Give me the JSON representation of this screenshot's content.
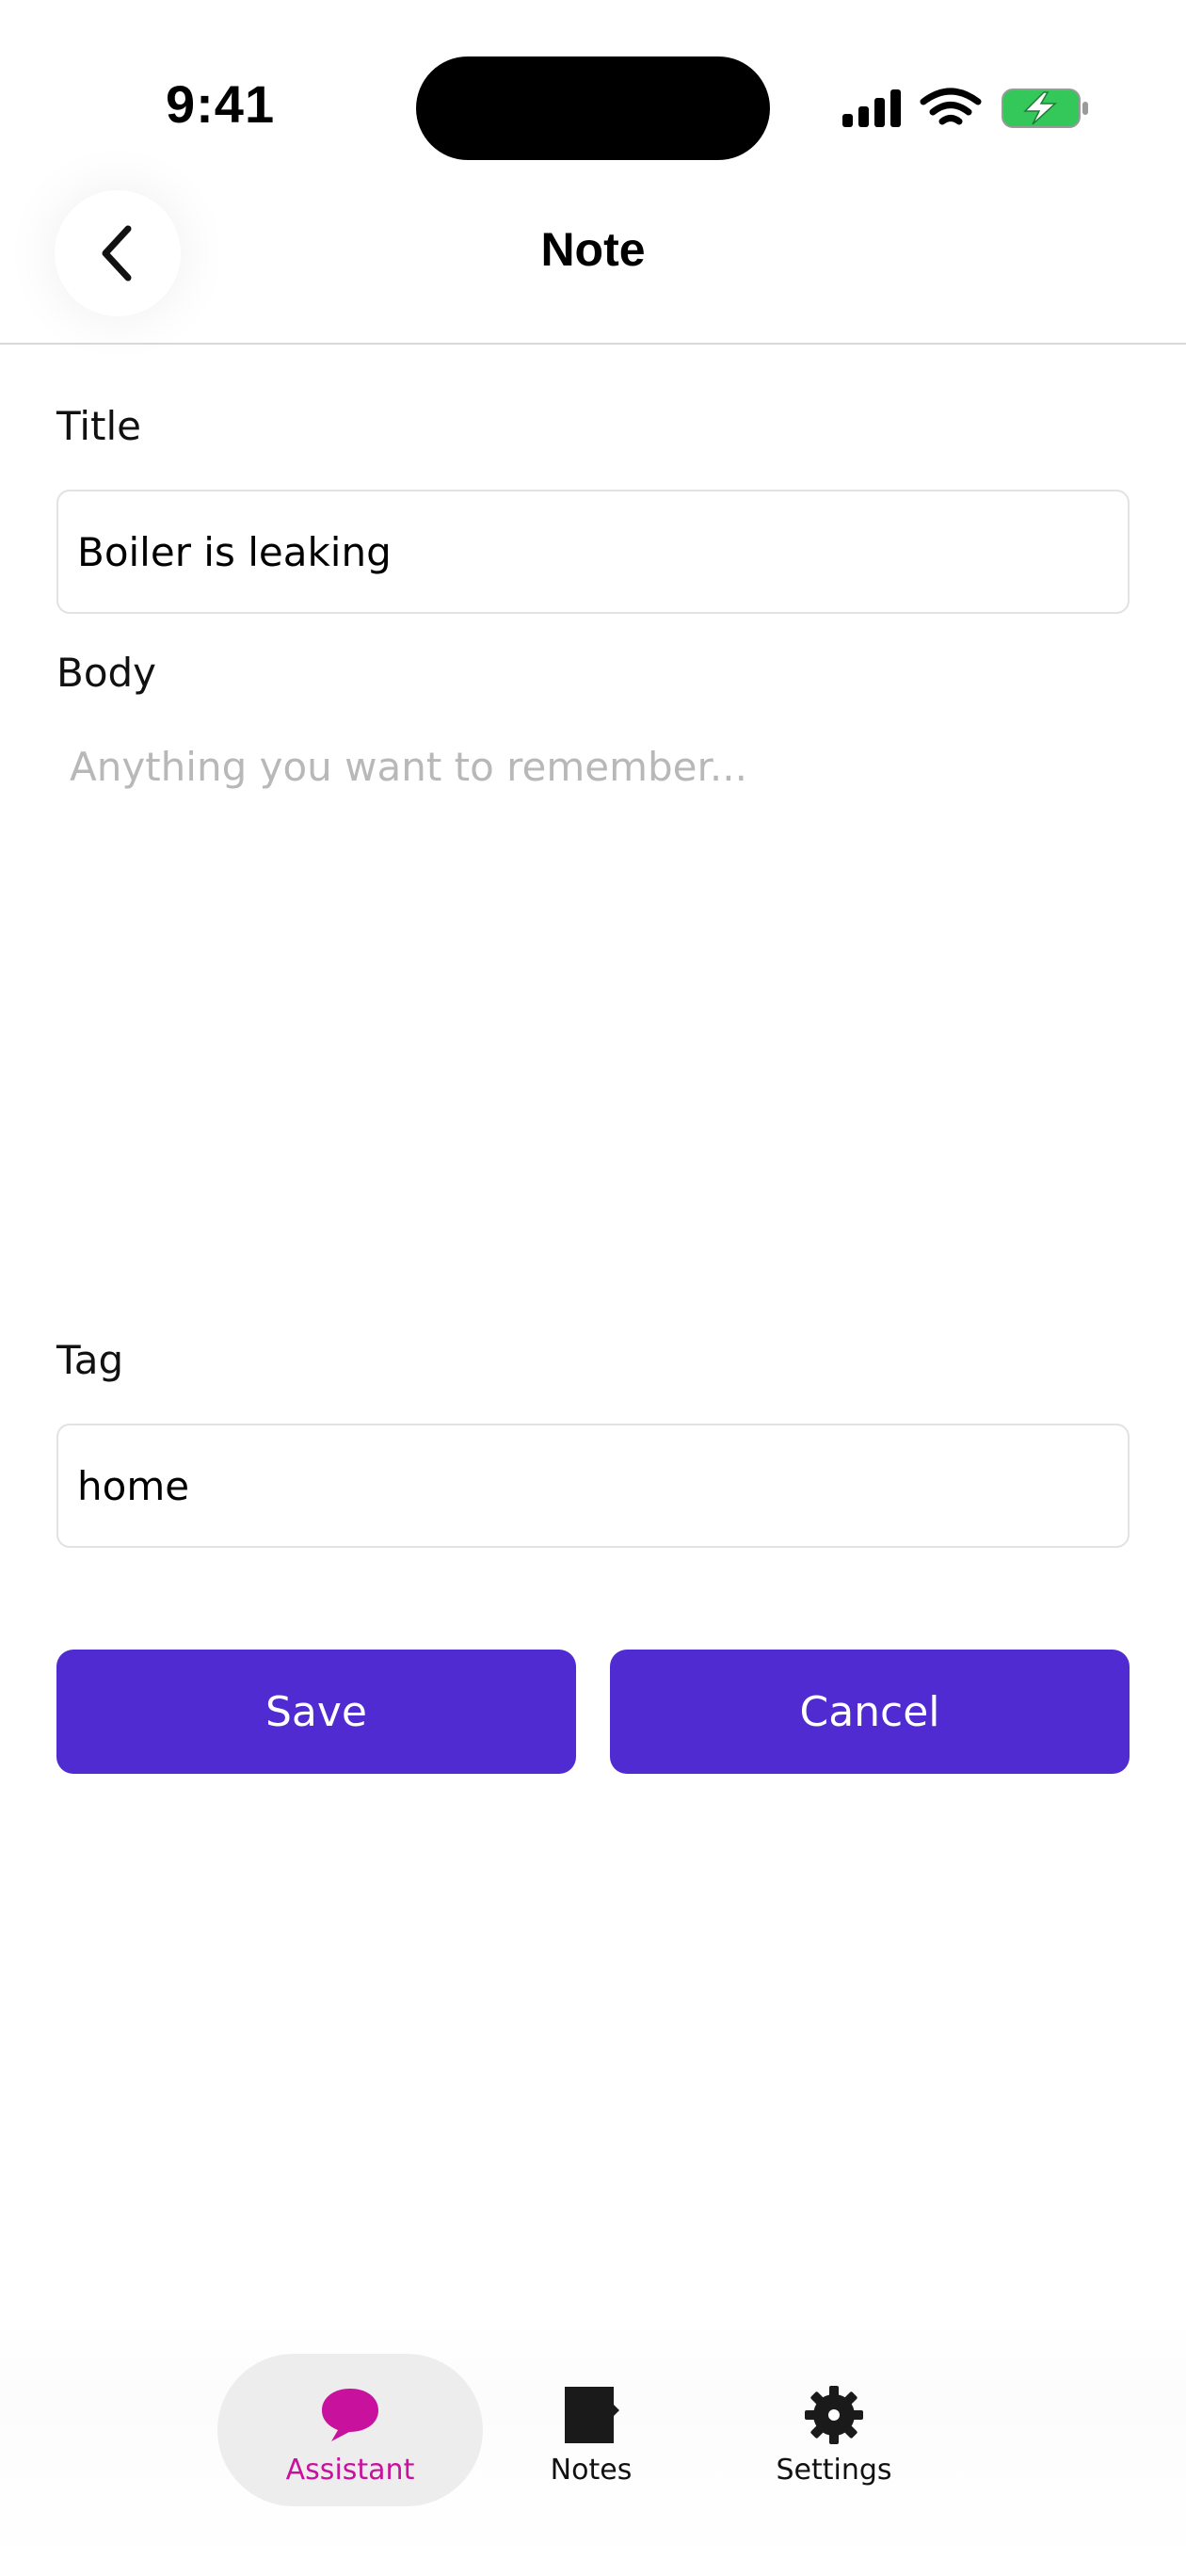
{
  "status_bar": {
    "time": "9:41",
    "icons": [
      "cellular-signal-icon",
      "wifi-icon",
      "battery-charging-icon"
    ],
    "battery_color": "#34c759"
  },
  "header": {
    "title": "Note",
    "back_icon": "chevron-left-icon"
  },
  "form": {
    "title_label": "Title",
    "title_value": "Boiler is leaking",
    "body_label": "Body",
    "body_value": "",
    "body_placeholder": "Anything you want to remember...",
    "tag_label": "Tag",
    "tag_value": "home"
  },
  "actions": {
    "save_label": "Save",
    "cancel_label": "Cancel",
    "button_color": "#4f2bd1"
  },
  "tab_bar": {
    "items": [
      {
        "label": "Assistant",
        "icon": "chat-bubble-icon",
        "active": true
      },
      {
        "label": "Notes",
        "icon": "note-icon",
        "active": false
      },
      {
        "label": "Settings",
        "icon": "gear-icon",
        "active": false
      }
    ],
    "active_color": "#c8119c"
  }
}
